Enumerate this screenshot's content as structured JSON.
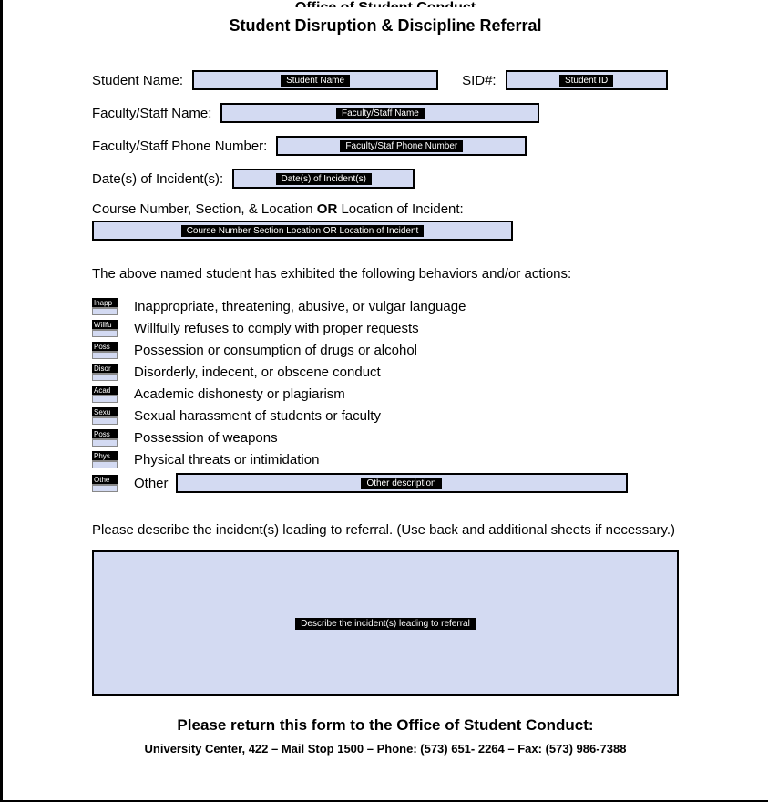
{
  "header_partial": "Office of Student Conduct",
  "title": "Student Disruption & Discipline Referral",
  "labels": {
    "student_name": "Student Name:",
    "sid": "SID#:",
    "faculty_name": "Faculty/Staff Name:",
    "faculty_phone": "Faculty/Staff Phone Number:",
    "dates": "Date(s) of Incident(s):",
    "course_prefix": "Course Number, Section, & Location ",
    "course_or": "OR",
    "course_suffix": " Location of Incident:"
  },
  "placeholders": {
    "student_name": "Student Name",
    "sid": "Student ID",
    "faculty_name": "Faculty/Staff Name",
    "faculty_phone": "Faculty/Staf Phone Number",
    "dates": "Date(s) of Incident(s)",
    "course": "Course Number Section  Location OR Location of Incident",
    "other": "Other description",
    "describe": "Describe the incident(s) leading to referral"
  },
  "behaviors_intro": "The above named student has exhibited the following behaviors and/or actions:",
  "behaviors": [
    {
      "tag": "Inapp",
      "text": "Inappropriate, threatening, abusive, or vulgar language"
    },
    {
      "tag": "Willfu",
      "text": "Willfully refuses to comply with proper requests"
    },
    {
      "tag": "Poss",
      "text": "Possession or consumption of drugs or alcohol"
    },
    {
      "tag": "Disor",
      "text": "Disorderly, indecent, or obscene conduct"
    },
    {
      "tag": "Acad",
      "text": "Academic dishonesty or plagiarism"
    },
    {
      "tag": "Sexu",
      "text": "Sexual harassment of students or faculty"
    },
    {
      "tag": "Poss",
      "text": "Possession of weapons"
    },
    {
      "tag": "Phys",
      "text": "Physical threats or intimidation"
    }
  ],
  "other_tag": "Othe",
  "other_label": "Other",
  "describe_label": "Please describe the incident(s) leading to referral.  (Use back and additional sheets if necessary.)",
  "footer_title": "Please return this form to the Office of Student Conduct:",
  "footer_address": "University Center, 422 – Mail Stop 1500 – Phone: (573) 651- 2264 – Fax: (573) 986-7388"
}
